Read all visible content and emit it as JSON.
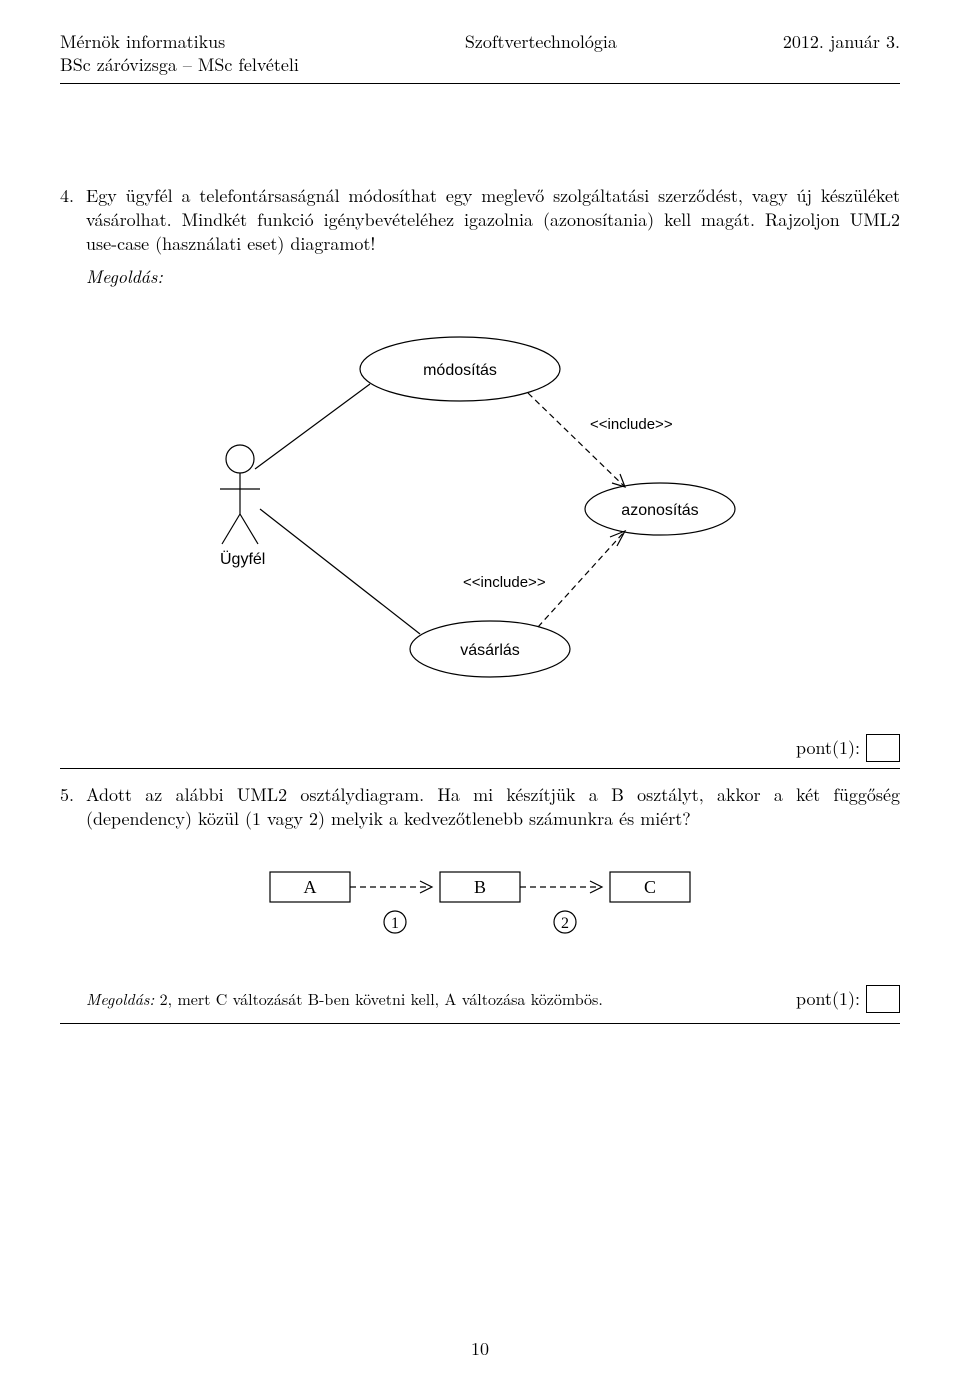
{
  "header": {
    "left1": "Mérnök informatikus",
    "left2": "BSc záróvizsga – MSc felvételi",
    "center": "Szoftvertechnológia",
    "right": "2012. január 3."
  },
  "q4": {
    "num": "4.",
    "text": "Egy ügyfél a telefontársaságnál módosíthat egy meglevő szolgáltatási szerződést, vagy új készüléket vásárolhat. Mindkét funkció igénybevételéhez igazolnia (azonosítania) kell magát. Rajzoljon UML2 use-case (használati eset) diagramot!",
    "solution_label": "Megoldás:",
    "diagram": {
      "actor": "Ügyfél",
      "usecases": {
        "modify": "módosítás",
        "identify": "azonosítás",
        "buy": "vásárlás"
      },
      "include": "<<include>>"
    },
    "points_label": "pont(1):"
  },
  "q5": {
    "num": "5.",
    "text": "Adott az alábbi UML2 osztálydiagram. Ha mi készítjük a B osztályt, akkor a két függőség (dependency) közül (1 vagy 2) melyik a kedvezőtlenebb számunkra és miért?",
    "classes": {
      "a": "A",
      "b": "B",
      "c": "C"
    },
    "labels": {
      "one": "1",
      "two": "2"
    },
    "solution_label": "Megoldás:",
    "solution_text": "2, mert C változását B-ben követni kell, A változása közömbös.",
    "points_label": "pont(1):"
  },
  "page_number": "10"
}
